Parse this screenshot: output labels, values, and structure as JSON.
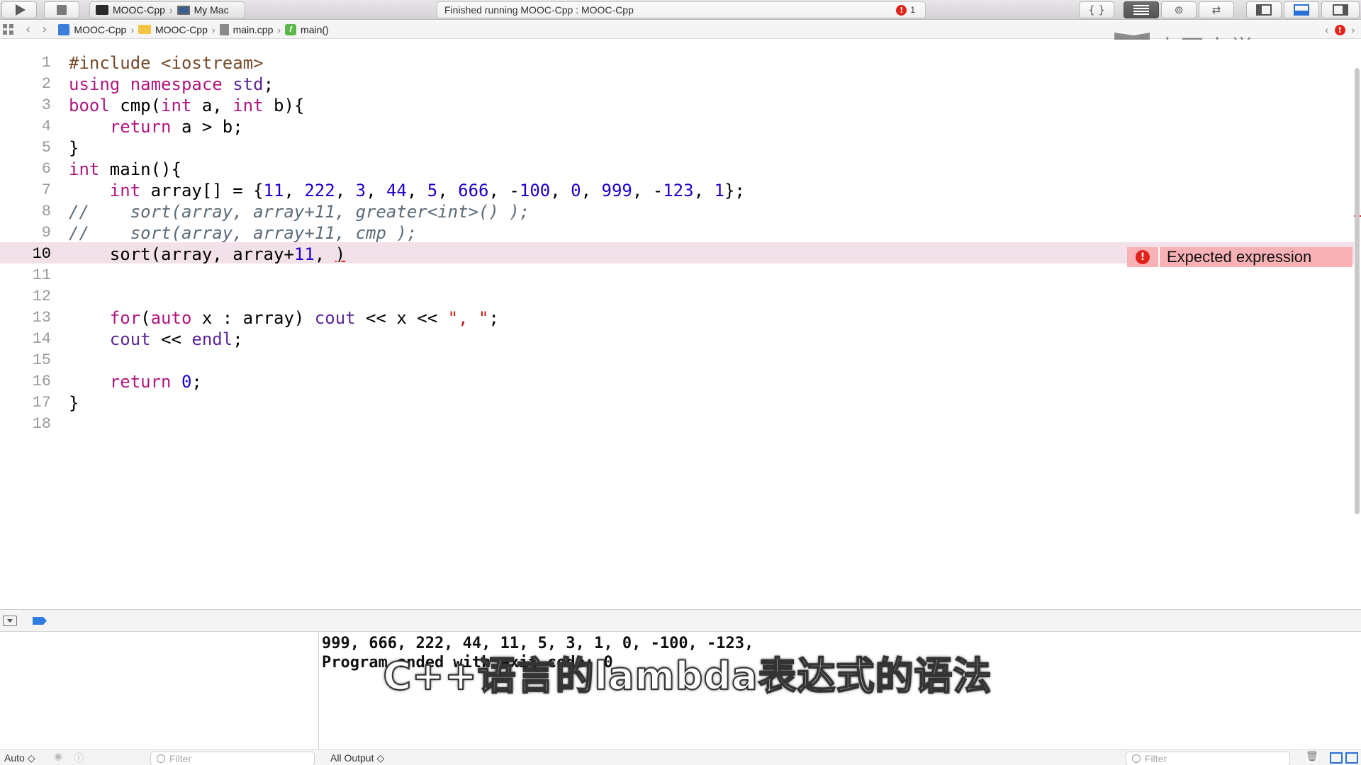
{
  "toolbar": {
    "scheme_target": "MOOC-Cpp",
    "scheme_device": "My Mac",
    "status_text": "Finished running MOOC-Cpp : MOOC-Cpp",
    "error_count": "1",
    "braces_label": "{ }",
    "exclaim": "!"
  },
  "jumpbar": {
    "crumbs": [
      "MOOC-Cpp",
      "MOOC-Cpp",
      "main.cpp",
      "main()"
    ],
    "func_glyph": "f",
    "back_arrow": "‹",
    "forward_arrow": "›"
  },
  "watermark": {
    "text": "中国大学MOOC"
  },
  "editor": {
    "line_numbers": [
      "1",
      "2",
      "3",
      "4",
      "5",
      "6",
      "7",
      "8",
      "9",
      "10",
      "11",
      "12",
      "13",
      "14",
      "15",
      "16",
      "17",
      "18"
    ],
    "error_line_index": 9,
    "issue_message": "Expected expression"
  },
  "debug": {
    "console_lines": [
      "999, 666, 222, 44, 11, 5, 3, 1, 0, -100, -123,",
      "Program ended with exit code: 0"
    ],
    "subtitle": "C++语言的lambda表达式的语法",
    "scope_selector": "Auto ◇",
    "output_selector": "All Output ◇",
    "filter_placeholder": "Filter"
  },
  "colors": {
    "keyword": "#b1167e",
    "number": "#1c00cf",
    "string": "#c41a16",
    "comment": "#5d6c79",
    "error": "#e2231a",
    "error_line_bg": "#f3e1e9"
  }
}
